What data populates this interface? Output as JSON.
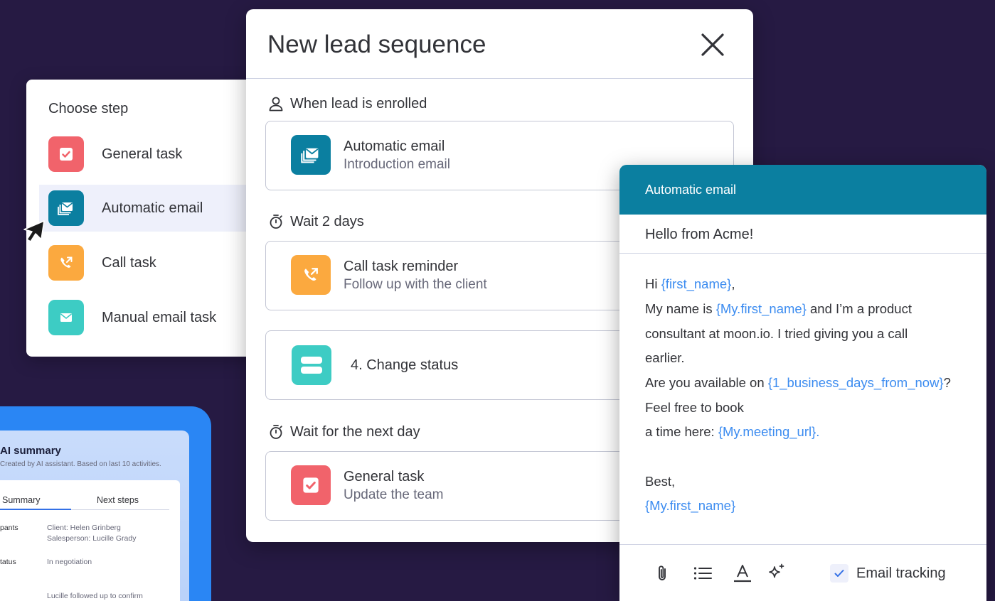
{
  "choose_step": {
    "title": "Choose step",
    "items": [
      {
        "label": "General task",
        "icon": "checkbox-icon",
        "color": "#f1636b"
      },
      {
        "label": "Automatic email",
        "icon": "email-stack-icon",
        "color": "#0b7fa0",
        "selected": true
      },
      {
        "label": "Call task",
        "icon": "phone-icon",
        "color": "#fba93f"
      },
      {
        "label": "Manual email task",
        "icon": "envelope-icon",
        "color": "#3dccc4"
      }
    ]
  },
  "ai_summary": {
    "title": "AI summary",
    "subtitle": "Created by AI assistant. Based on last 10 activities.",
    "tabs": [
      "Summary",
      "Next steps"
    ],
    "rows": [
      {
        "key": "pants",
        "lines": [
          "Client: Helen Grinberg",
          "Salesperson: Lucille Grady"
        ]
      },
      {
        "key": "tatus",
        "lines": [
          "In negotiation"
        ]
      },
      {
        "key": "",
        "lines": [
          "Lucille followed up to confirm"
        ]
      }
    ]
  },
  "sequence": {
    "title": "New lead sequence",
    "triggers": [
      "When lead is enrolled",
      "Wait 2 days",
      "Wait for the next day"
    ],
    "cards": [
      {
        "title": "Automatic email",
        "subtitle": "Introduction email"
      },
      {
        "title": "Call task reminder",
        "subtitle": "Follow up with the client"
      },
      {
        "title": "4. Change status"
      },
      {
        "title": "General task",
        "subtitle": "Update the team"
      }
    ]
  },
  "email": {
    "header": "Automatic email",
    "subject": "Hello from Acme!",
    "body": {
      "l1_a": "Hi ",
      "l1_var": "{first_name}",
      "l1_b": ",",
      "l2_a": "My name is ",
      "l2_var": "{My.first_name}",
      "l2_b": " and I’m a product",
      "l3": "consultant at moon.io. I tried giving you a call",
      "l4": "earlier.",
      "l5_a": "Are you available on ",
      "l5_var": "{1_business_days_from_now}",
      "l5_b": "?",
      "l6": "Feel free to book",
      "l7_a": "a time here: ",
      "l7_var": "{My.meeting_url}.",
      "l8": "Best,",
      "l9_var": "{My.first_name}"
    },
    "toolbar": [
      "attachment-icon",
      "list-icon",
      "text-color-icon",
      "ai-sparkle-icon"
    ],
    "tracking_label": "Email tracking",
    "tracking_checked": true
  },
  "colors": {
    "background": "#261a43",
    "email_header": "#0b7fa0",
    "variable": "#3c8cf0",
    "ai_card": "#2a86f4"
  }
}
